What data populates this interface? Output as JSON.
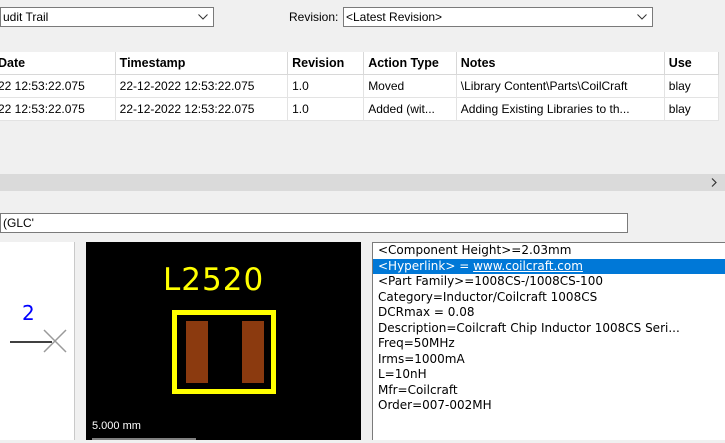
{
  "toolbar": {
    "view_select": "udit Trail",
    "revision_label": "Revision:",
    "revision_select": "<Latest Revision>"
  },
  "grid": {
    "columns": [
      "Date",
      "Timestamp",
      "Revision",
      "Action Type",
      "Notes",
      "Use"
    ],
    "rows": [
      [
        "22 12:53:22.075",
        "22-12-2022 12:53:22.075",
        "1.0",
        "Moved",
        "\\Library Content\\Parts\\CoilCraft",
        "blay"
      ],
      [
        "22 12:53:22.075",
        "22-12-2022 12:53:22.075",
        "1.0",
        "Added (wit...",
        "Adding Existing Libraries to th...",
        "blay"
      ]
    ]
  },
  "filter": {
    "value": "(GLC'"
  },
  "symbol": {
    "pin_number": "2"
  },
  "footprint": {
    "designator": "L2520",
    "scale": "5.000 mm"
  },
  "parameters": {
    "lines": [
      "<Component Height>=2.03mm",
      "<Hyperlink> = ",
      "<Part Family>=1008CS-/1008CS-100",
      "Category=Inductor/Coilcraft 1008CS",
      "DCRmax = 0.08",
      "Description=Coilcraft Chip Inductor 1008CS Seri...",
      "Freq=50MHz",
      "Irms=1000mA",
      "L=10nH",
      "Mfr=Coilcraft",
      "Order=007-002MH"
    ],
    "link": "www.coilcraft.com"
  },
  "colors": {
    "selection": "#0078d7",
    "footprint_yellow": "#ffff00",
    "pad_brown": "#8b3a0f",
    "pin_blue": "#0000ff"
  }
}
